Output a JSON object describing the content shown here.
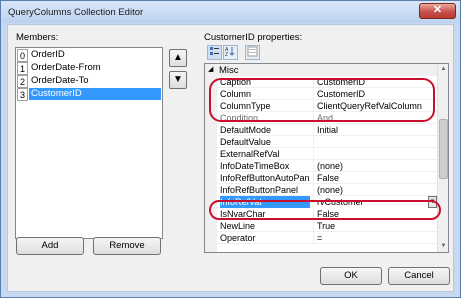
{
  "window": {
    "title": "QueryColumns Collection Editor",
    "close_glyph": "✕"
  },
  "members": {
    "label": "Members:",
    "items": [
      {
        "index": "0",
        "name": "OrderID",
        "selected": false
      },
      {
        "index": "1",
        "name": "OrderDate-From",
        "selected": false
      },
      {
        "index": "2",
        "name": "OrderDate-To",
        "selected": false
      },
      {
        "index": "3",
        "name": "CustomerID",
        "selected": true
      }
    ],
    "move_up_icon": "▲",
    "move_down_icon": "▼",
    "add_label": "Add",
    "remove_label": "Remove"
  },
  "properties": {
    "label": "CustomerID properties:",
    "category_toggle": "◢",
    "category": "Misc",
    "rows": [
      {
        "name": "Caption",
        "value": "CustomerID",
        "gray": false
      },
      {
        "name": "Column",
        "value": "CustomerID",
        "gray": false
      },
      {
        "name": "ColumnType",
        "value": "ClientQueryRefValColumn",
        "gray": false
      },
      {
        "name": "Condition",
        "value": "And",
        "gray": true
      },
      {
        "name": "DefaultMode",
        "value": "Initial",
        "gray": false
      },
      {
        "name": "DefaultValue",
        "value": "",
        "gray": false
      },
      {
        "name": "ExternalRefVal",
        "value": "",
        "gray": false
      },
      {
        "name": "InfoDateTimeBox",
        "value": "(none)",
        "gray": false
      },
      {
        "name": "InfoRefButtonAutoPanel",
        "value": "False",
        "gray": false
      },
      {
        "name": "InfoRefButtonPanel",
        "value": "(none)",
        "gray": false
      },
      {
        "name": "InfoRefVal",
        "value": "rvCustomer",
        "gray": false
      },
      {
        "name": "IsNvarChar",
        "value": "False",
        "gray": false
      },
      {
        "name": "NewLine",
        "value": "True",
        "gray": false
      },
      {
        "name": "Operator",
        "value": "=",
        "gray": false
      }
    ],
    "selected_row": "InfoRefVal",
    "dropdown_glyph": "▼"
  },
  "toolbar": {
    "categorized_icon": "categorized-icon",
    "alphabetical_icon": "alphabetical-icon",
    "property_pages_icon": "property-pages-icon"
  },
  "footer": {
    "ok_label": "OK",
    "cancel_label": "Cancel"
  },
  "colors": {
    "selection": "#3399ff",
    "highlight_oval": "#c8102e",
    "close_button": "#c75050"
  }
}
